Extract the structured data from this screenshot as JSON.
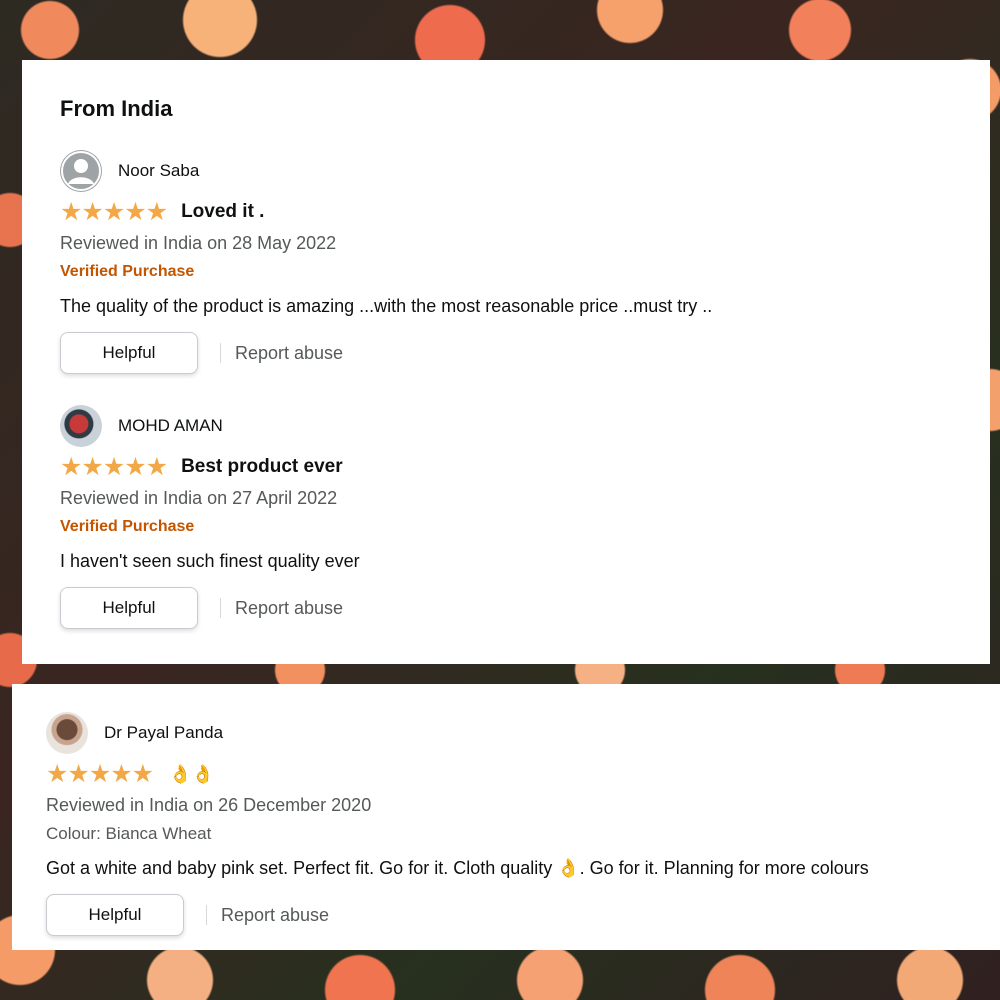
{
  "section_title": "From India",
  "reviews": [
    {
      "name": "Noor Saba",
      "avatar": "default-avatar-icon",
      "rating": 5,
      "stars": "★★★★★",
      "title": "Loved it .",
      "meta": "Reviewed in India on 28 May 2022",
      "badge": "Verified Purchase",
      "body": "The quality of the product is amazing ...with the most reasonable price ..must try ..",
      "helpful": "Helpful",
      "report": "Report abuse"
    },
    {
      "name": "MOHD AMAN",
      "avatar": "user-photo",
      "rating": 5,
      "stars": "★★★★★",
      "title": "Best product ever",
      "meta": "Reviewed in India on 27 April 2022",
      "badge": "Verified Purchase",
      "body": "I haven't seen such finest quality ever",
      "helpful": "Helpful",
      "report": "Report abuse"
    },
    {
      "name": "Dr Payal Panda",
      "avatar": "user-photo",
      "rating": 5,
      "stars": "★★★★★",
      "title": "👌👌",
      "meta": "Reviewed in India on 26 December 2020",
      "variant": "Colour: Bianca Wheat",
      "body": "Got a white and baby pink set. Perfect fit. Go for it. Cloth quality 👌. Go for it. Planning for more colours",
      "helpful": "Helpful",
      "report": "Report abuse"
    }
  ],
  "colors": {
    "star": "#f3a847",
    "verified": "#c45500",
    "meta": "#565959"
  }
}
